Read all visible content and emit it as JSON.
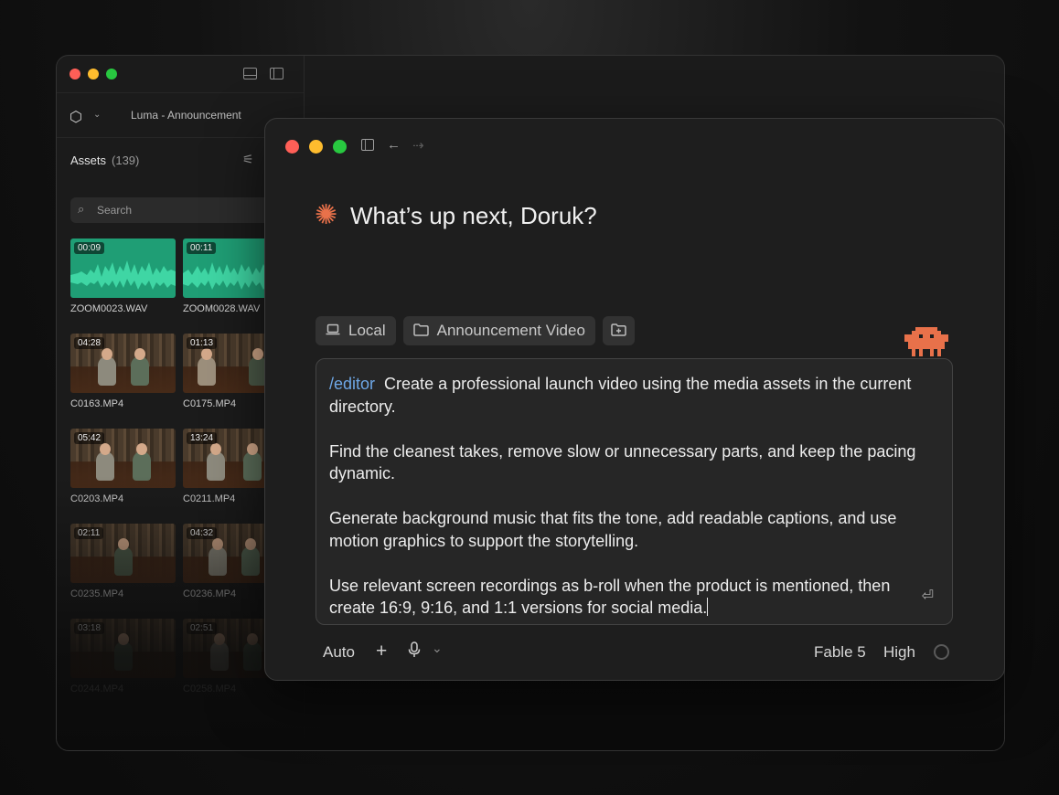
{
  "back_window": {
    "project_name": "Luma - Announcement",
    "assets_label": "Assets",
    "assets_count": "(139)",
    "search_placeholder": "Search",
    "assets": [
      {
        "duration": "00:09",
        "name": "ZOOM0023.WAV",
        "kind": "audio"
      },
      {
        "duration": "00:11",
        "name": "ZOOM0028.WAV",
        "kind": "audio"
      },
      {
        "duration": "04:28",
        "name": "C0163.MP4",
        "kind": "video"
      },
      {
        "duration": "01:13",
        "name": "C0175.MP4",
        "kind": "video"
      },
      {
        "duration": "05:42",
        "name": "C0203.MP4",
        "kind": "video"
      },
      {
        "duration": "13:24",
        "name": "C0211.MP4",
        "kind": "video"
      },
      {
        "duration": "02:11",
        "name": "C0235.MP4",
        "kind": "video"
      },
      {
        "duration": "04:32",
        "name": "C0236.MP4",
        "kind": "video"
      },
      {
        "duration": "03:18",
        "name": "C0244.MP4",
        "kind": "video"
      },
      {
        "duration": "02:51",
        "name": "C0258.MP4",
        "kind": "video"
      }
    ]
  },
  "front_window": {
    "greeting": "What’s up next, Doruk?",
    "chips": {
      "local": "Local",
      "folder": "Announcement Video"
    },
    "prompt": {
      "command": "/editor",
      "line1": "Create a professional launch video using the media assets in the current directory.",
      "para2": "Find the cleanest takes, remove slow or unnecessary parts, and keep the pacing dynamic.",
      "para3": "Generate background music that fits the tone, add readable captions, and use motion graphics to support the storytelling.",
      "para4": "Use relevant screen recordings as b-roll when the product is mentioned, then create 16:9, 9:16, and 1:1 versions for social media."
    },
    "bottom_bar": {
      "mode": "Auto",
      "model": "Fable 5",
      "effort": "High"
    },
    "colors": {
      "accent_star": "#e8714a",
      "command": "#6ea7e6",
      "audio_thumb": "#1f9e75"
    }
  }
}
